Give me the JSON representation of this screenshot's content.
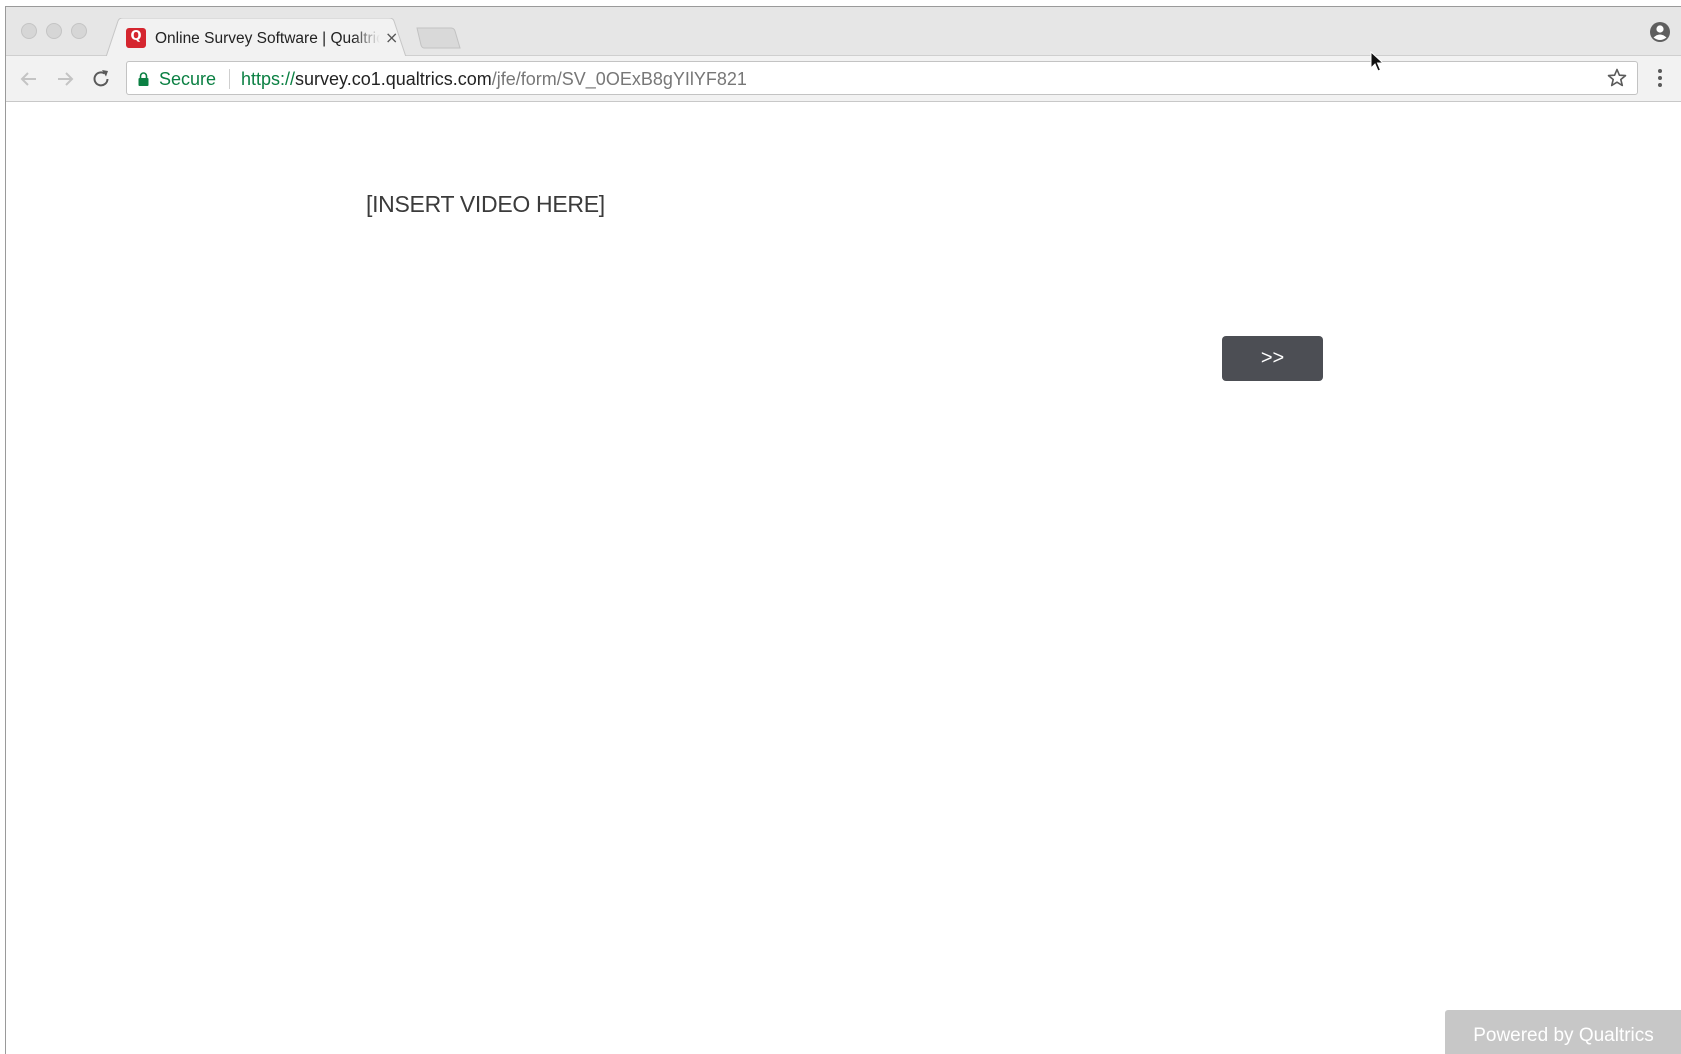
{
  "browser": {
    "tab": {
      "title": "Online Survey Software | Qualtrics Survey Solutions",
      "favicon_letter": "Q",
      "favicon_color": "#d5262f",
      "close_glyph": "×"
    },
    "address_bar": {
      "security_label": "Secure",
      "url_scheme": "https://",
      "url_host": "survey.co1.qualtrics.com",
      "url_path": "/jfe/form/SV_0OExB8gYIlYF821",
      "secure_color": "#0b8043"
    },
    "icons": {
      "back": "back-arrow-icon",
      "forward": "forward-arrow-icon",
      "reload": "reload-icon",
      "lock": "lock-icon",
      "bookmark": "star-icon",
      "menu": "kebab-menu-icon",
      "profile": "profile-icon"
    }
  },
  "survey": {
    "question_text": "[INSERT VIDEO HERE]",
    "next_button_label": ">>",
    "next_button_color": "#4c4e54",
    "footer_label": "Powered by Qualtrics"
  }
}
